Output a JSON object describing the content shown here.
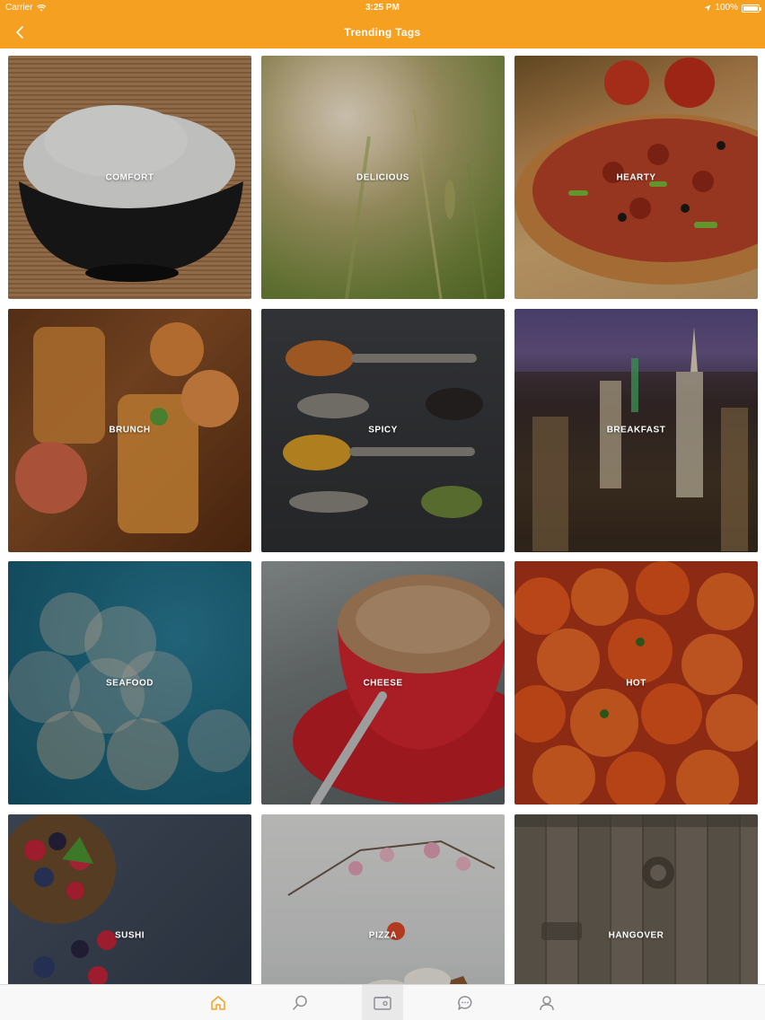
{
  "status_bar": {
    "carrier": "Carrier",
    "time": "3:25 PM",
    "battery": "100%"
  },
  "nav": {
    "title": "Trending Tags"
  },
  "colors": {
    "accent": "#f5a020",
    "tab_active": "#f5a020",
    "tab_inactive": "#8e8e93"
  },
  "tiles": [
    {
      "label": "COMFORT"
    },
    {
      "label": "DELICIOUS"
    },
    {
      "label": "HEARTY"
    },
    {
      "label": "BRUNCH"
    },
    {
      "label": "SPICY"
    },
    {
      "label": "BREAKFAST"
    },
    {
      "label": "SEAFOOD"
    },
    {
      "label": "CHEESE"
    },
    {
      "label": "HOT"
    },
    {
      "label": "SUSHI"
    },
    {
      "label": "PIZZA"
    },
    {
      "label": "HANGOVER"
    }
  ],
  "tabbar": {
    "tabs": [
      {
        "icon": "home-icon",
        "active": true
      },
      {
        "icon": "search-icon",
        "active": false
      },
      {
        "icon": "wallet-icon",
        "active": false
      },
      {
        "icon": "chat-icon",
        "active": false
      },
      {
        "icon": "profile-icon",
        "active": false
      }
    ]
  }
}
